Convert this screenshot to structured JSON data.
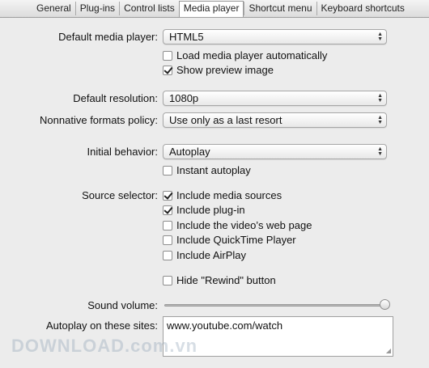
{
  "tabs": [
    {
      "label": "General",
      "active": false
    },
    {
      "label": "Plug-ins",
      "active": false
    },
    {
      "label": "Control lists",
      "active": false
    },
    {
      "label": "Media player",
      "active": true
    },
    {
      "label": "Shortcut menu",
      "active": false
    },
    {
      "label": "Keyboard shortcuts",
      "active": false
    }
  ],
  "default_media_player": {
    "label": "Default media player:",
    "value": "HTML5"
  },
  "load_auto": {
    "label": "Load media player automatically",
    "checked": false
  },
  "show_preview": {
    "label": "Show preview image",
    "checked": true
  },
  "default_resolution": {
    "label": "Default resolution:",
    "value": "1080p"
  },
  "nonnative_policy": {
    "label": "Nonnative formats policy:",
    "value": "Use only as a last resort"
  },
  "initial_behavior": {
    "label": "Initial behavior:",
    "value": "Autoplay"
  },
  "instant_autoplay": {
    "label": "Instant autoplay",
    "checked": false
  },
  "source_selector": {
    "label": "Source selector:",
    "options": [
      {
        "label": "Include media sources",
        "checked": true
      },
      {
        "label": "Include plug-in",
        "checked": true
      },
      {
        "label": "Include the video’s web page",
        "checked": false
      },
      {
        "label": "Include QuickTime Player",
        "checked": false
      },
      {
        "label": "Include AirPlay",
        "checked": false
      }
    ]
  },
  "hide_rewind": {
    "label": "Hide \"Rewind\" button",
    "checked": false
  },
  "sound_volume": {
    "label": "Sound volume:",
    "level": 1.0
  },
  "autoplay_sites": {
    "label": "Autoplay on these sites:",
    "value": "www.youtube.com/watch"
  },
  "watermark": "DOWNLOAD.com.vn"
}
